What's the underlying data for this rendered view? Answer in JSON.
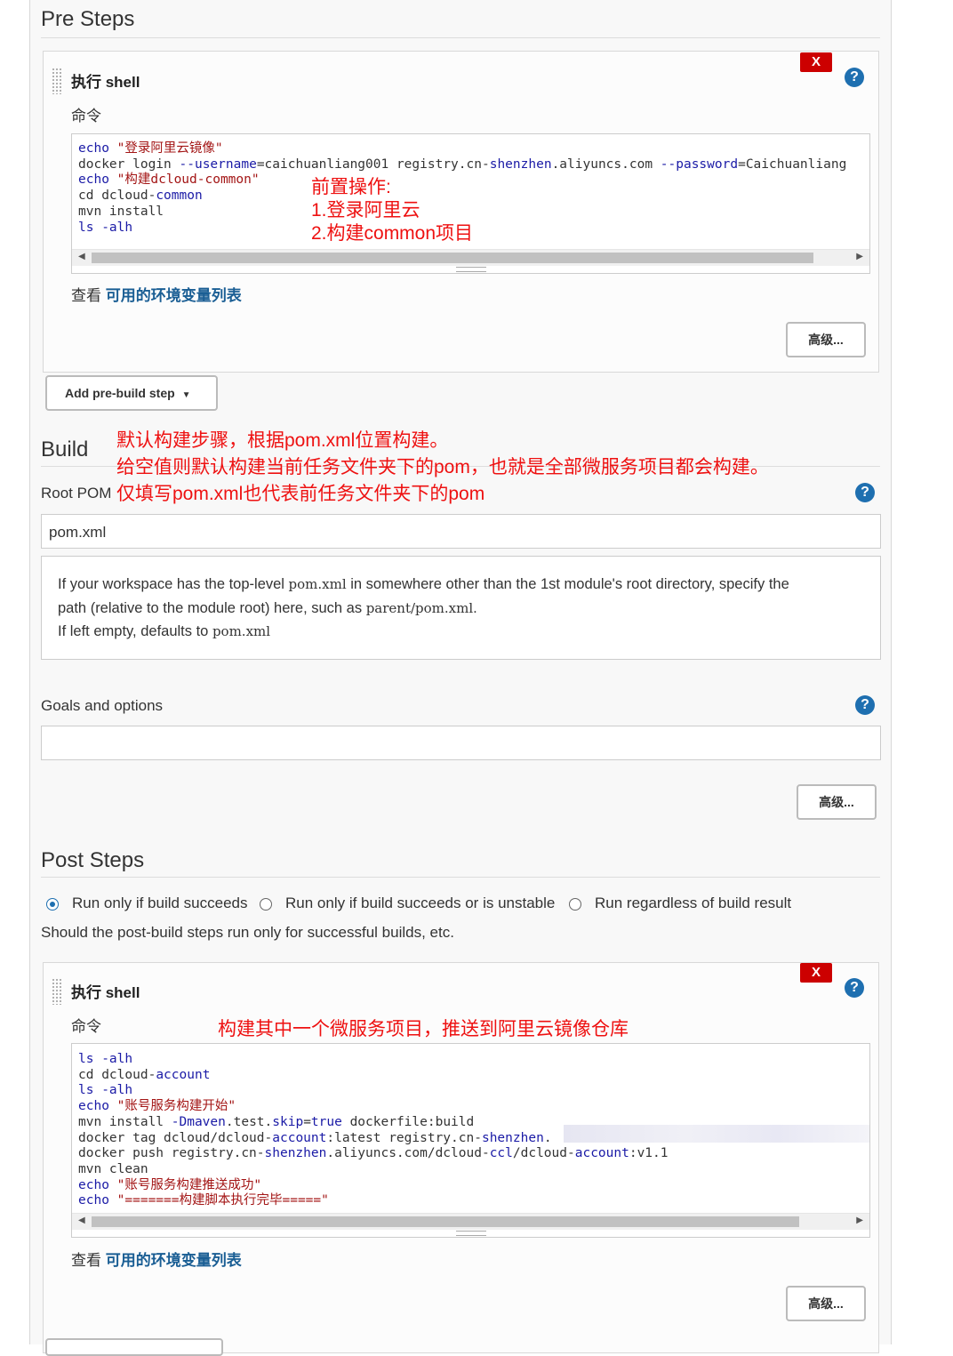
{
  "pre_steps": {
    "title": "Pre Steps",
    "step": {
      "title": "执行 shell",
      "delete_label": "X",
      "help_label": "?",
      "command_label": "命令",
      "code_lines": [
        [
          {
            "t": "echo",
            "c": "#1a1aa6"
          },
          {
            "t": " \"登录阿里云镜像\"",
            "c": "#a31515"
          }
        ],
        [
          {
            "t": "docker login ",
            "c": "#333"
          },
          {
            "t": "--username",
            "c": "#1a1aa6"
          },
          {
            "t": "=caichuanliang001 registry.cn-",
            "c": "#333"
          },
          {
            "t": "shenzhen",
            "c": "#1a1aa6"
          },
          {
            "t": ".aliyuncs.com ",
            "c": "#333"
          },
          {
            "t": "--password",
            "c": "#1a1aa6"
          },
          {
            "t": "=Caichuanliang",
            "c": "#333"
          }
        ],
        [
          {
            "t": "echo",
            "c": "#1a1aa6"
          },
          {
            "t": " \"构建dcloud-common\"",
            "c": "#a31515"
          }
        ],
        [
          {
            "t": "cd dcloud-",
            "c": "#333"
          },
          {
            "t": "common",
            "c": "#1a1aa6"
          }
        ],
        [
          {
            "t": "mvn install",
            "c": "#333"
          }
        ],
        [
          {
            "t": "ls ",
            "c": "#1a1aa6"
          },
          {
            "t": "-alh",
            "c": "#1a1aa6"
          }
        ]
      ],
      "env_prefix": "查看 ",
      "env_link": "可用的环境变量列表",
      "advanced_label": "高级..."
    },
    "annotation": [
      "前置操作:",
      "1.登录阿里云",
      "2.构建common项目"
    ],
    "add_button": "Add pre-build step"
  },
  "build": {
    "title": "Build",
    "annotation": [
      "默认构建步骤，根据pom.xml位置构建。",
      "给空值则默认构建当前任务文件夹下的pom，也就是全部微服务项目都会构建。",
      "仅填写pom.xml也代表前任务文件夹下的pom"
    ],
    "root_pom_label": "Root POM",
    "root_pom_value": "pom.xml",
    "help_text": {
      "l1a": "If your workspace has the top-level ",
      "l1b": "pom.xml",
      "l1c": " in somewhere other than the 1st module's root directory, specify the",
      "l2a": "path (relative to the module root) here, such as ",
      "l2b": "parent/pom.xml",
      "l2c": ".",
      "l3a": "If left empty, defaults to ",
      "l3b": "pom.xml"
    },
    "goals_label": "Goals and options",
    "goals_value": "",
    "advanced_label": "高级..."
  },
  "post_steps": {
    "title": "Post Steps",
    "radios": [
      {
        "label": "Run only if build succeeds",
        "checked": true
      },
      {
        "label": "Run only if build succeeds or is unstable",
        "checked": false
      },
      {
        "label": "Run regardless of build result",
        "checked": false
      }
    ],
    "description": "Should the post-build steps run only for successful builds, etc.",
    "step": {
      "title": "执行 shell",
      "delete_label": "X",
      "help_label": "?",
      "command_label": "命令",
      "code_lines": [
        [
          {
            "t": "ls ",
            "c": "#1a1aa6"
          },
          {
            "t": "-alh",
            "c": "#1a1aa6"
          }
        ],
        [
          {
            "t": "cd dcloud-",
            "c": "#333"
          },
          {
            "t": "account",
            "c": "#1a1aa6"
          }
        ],
        [
          {
            "t": "ls ",
            "c": "#1a1aa6"
          },
          {
            "t": "-alh",
            "c": "#1a1aa6"
          }
        ],
        [
          {
            "t": "echo",
            "c": "#1a1aa6"
          },
          {
            "t": " \"账号服务构建开始\"",
            "c": "#a31515"
          }
        ],
        [
          {
            "t": "mvn install ",
            "c": "#333"
          },
          {
            "t": "-Dmaven",
            "c": "#1a1aa6"
          },
          {
            "t": ".test.",
            "c": "#333"
          },
          {
            "t": "skip",
            "c": "#1a1aa6"
          },
          {
            "t": "=",
            "c": "#333"
          },
          {
            "t": "true",
            "c": "#1a1aa6"
          },
          {
            "t": " dockerfile:build",
            "c": "#333"
          }
        ],
        [
          {
            "t": "docker tag dcloud/dcloud-",
            "c": "#333"
          },
          {
            "t": "account",
            "c": "#1a1aa6"
          },
          {
            "t": ":latest registry.cn-",
            "c": "#333"
          },
          {
            "t": "shenzhen",
            "c": "#1a1aa6"
          },
          {
            "t": ".",
            "c": "#333"
          }
        ],
        [
          {
            "t": "docker push registry.cn-",
            "c": "#333"
          },
          {
            "t": "shenzhen",
            "c": "#1a1aa6"
          },
          {
            "t": ".aliyuncs.com/dcloud-",
            "c": "#333"
          },
          {
            "t": "ccl",
            "c": "#1a1aa6"
          },
          {
            "t": "/dcloud-",
            "c": "#333"
          },
          {
            "t": "account",
            "c": "#1a1aa6"
          },
          {
            "t": ":v1.1",
            "c": "#333"
          }
        ],
        [
          {
            "t": "mvn clean",
            "c": "#333"
          }
        ],
        [
          {
            "t": "echo",
            "c": "#1a1aa6"
          },
          {
            "t": " \"账号服务构建推送成功\"",
            "c": "#a31515"
          }
        ],
        [
          {
            "t": "echo",
            "c": "#1a1aa6"
          },
          {
            "t": " \"=======构建脚本执行完毕=====\"",
            "c": "#a31515"
          }
        ]
      ],
      "env_prefix": "查看 ",
      "env_link": "可用的环境变量列表",
      "advanced_label": "高级..."
    },
    "annotation": "构建其中一个微服务项目，推送到阿里云镜像仓库"
  },
  "colors": {
    "annotation_red": "#ee1111",
    "help_blue": "#1e6fb0",
    "link_blue": "#1a5e94",
    "delete_red": "#cc0000"
  }
}
